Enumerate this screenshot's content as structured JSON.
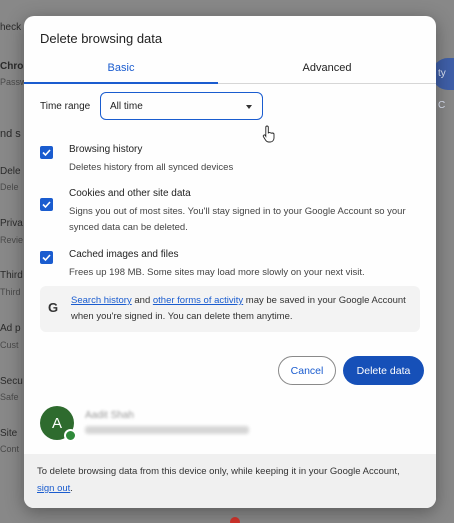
{
  "background": {
    "fragments": [
      "heck",
      "Chron",
      "Passw",
      "nd s",
      "Dele",
      "Dele",
      "Priva",
      "Revie",
      "Third",
      "Third",
      "Ad p",
      "Cust",
      "Secu",
      "Safe",
      "Site",
      "Cont"
    ],
    "right_button": "ty C"
  },
  "dialog": {
    "title": "Delete browsing data",
    "tabs": [
      {
        "label": "Basic",
        "selected": true
      },
      {
        "label": "Advanced",
        "selected": false
      }
    ],
    "time_range": {
      "label": "Time range",
      "value": "All time"
    },
    "options": [
      {
        "title": "Browsing history",
        "description": "Deletes history from all synced devices",
        "checked": true
      },
      {
        "title": "Cookies and other site data",
        "description": "Signs you out of most sites. You'll stay signed in to your Google Account so your synced data can be deleted.",
        "checked": true
      },
      {
        "title": "Cached images and files",
        "description": "Frees up 198 MB. Some sites may load more slowly on your next visit.",
        "checked": true
      }
    ],
    "info": {
      "icon": "G",
      "link1": "Search history",
      "mid": " and ",
      "link2": "other forms of activity",
      "rest": " may be saved in your Google Account when you're signed in. You can delete them anytime."
    },
    "buttons": {
      "cancel": "Cancel",
      "delete": "Delete data"
    },
    "account": {
      "initial": "A",
      "name": "Aadit Shah"
    },
    "footer": {
      "text": "To delete browsing data from this device only, while keeping it in your Google Account, ",
      "link": "sign out",
      "end": "."
    }
  },
  "colors": {
    "accent": "#1a5ccf",
    "delete_button": "#1650b8",
    "avatar": "#2e6b2e"
  }
}
